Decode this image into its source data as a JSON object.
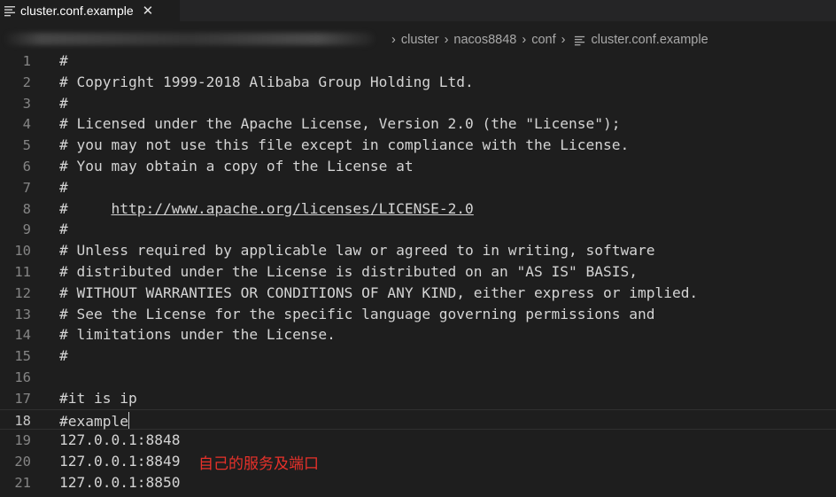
{
  "tab": {
    "title": "cluster.conf.example",
    "close_glyph": "✕",
    "icon": "lines-icon"
  },
  "breadcrumb": {
    "items": [
      "cluster",
      "nacos8848",
      "conf"
    ],
    "file": "cluster.conf.example",
    "separator": "›"
  },
  "editor": {
    "current_line": 18,
    "lines": [
      {
        "num": "1",
        "text": "#"
      },
      {
        "num": "2",
        "text": "# Copyright 1999-2018 Alibaba Group Holding Ltd."
      },
      {
        "num": "3",
        "text": "#"
      },
      {
        "num": "4",
        "text": "# Licensed under the Apache License, Version 2.0 (the \"License\");"
      },
      {
        "num": "5",
        "text": "# you may not use this file except in compliance with the License."
      },
      {
        "num": "6",
        "text": "# You may obtain a copy of the License at"
      },
      {
        "num": "7",
        "text": "#"
      },
      {
        "num": "8",
        "text": "#     ",
        "link": "http://www.apache.org/licenses/LICENSE-2.0"
      },
      {
        "num": "9",
        "text": "#"
      },
      {
        "num": "10",
        "text": "# Unless required by applicable law or agreed to in writing, software"
      },
      {
        "num": "11",
        "text": "# distributed under the License is distributed on an \"AS IS\" BASIS,"
      },
      {
        "num": "12",
        "text": "# WITHOUT WARRANTIES OR CONDITIONS OF ANY KIND, either express or implied."
      },
      {
        "num": "13",
        "text": "# See the License for the specific language governing permissions and"
      },
      {
        "num": "14",
        "text": "# limitations under the License."
      },
      {
        "num": "15",
        "text": "#"
      },
      {
        "num": "16",
        "text": ""
      },
      {
        "num": "17",
        "text": "#it is ip"
      },
      {
        "num": "18",
        "text": "#example"
      },
      {
        "num": "19",
        "text": "127.0.0.1:8848"
      },
      {
        "num": "20",
        "text": "127.0.0.1:8849"
      },
      {
        "num": "21",
        "text": "127.0.0.1:8850"
      }
    ]
  },
  "annotation": {
    "text": "自己的服务及端口",
    "color": "#e8312a"
  },
  "colors": {
    "background": "#1e1e1e",
    "text": "#d4d4d4",
    "line_number": "#858585"
  }
}
